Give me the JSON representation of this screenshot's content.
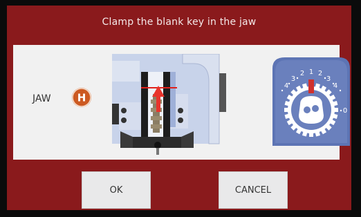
{
  "header": {
    "title": "Clamp the blank key in the jaw"
  },
  "jaw": {
    "label": "JAW",
    "badge_letter": "H"
  },
  "dial": {
    "labels": [
      "4",
      "3",
      "2",
      "1",
      "2",
      "3",
      "4",
      "0"
    ]
  },
  "buttons": {
    "ok_label": "OK",
    "cancel_label": "CANCEL"
  },
  "colors": {
    "screen_background": "#8a1a1c",
    "panel_background": "#f1f1f1",
    "badge_orange": "#cc5a22",
    "diagram_blue": "#c8d3ea",
    "dial_blue": "#5d74b4",
    "indicator_red": "#d0312d"
  }
}
